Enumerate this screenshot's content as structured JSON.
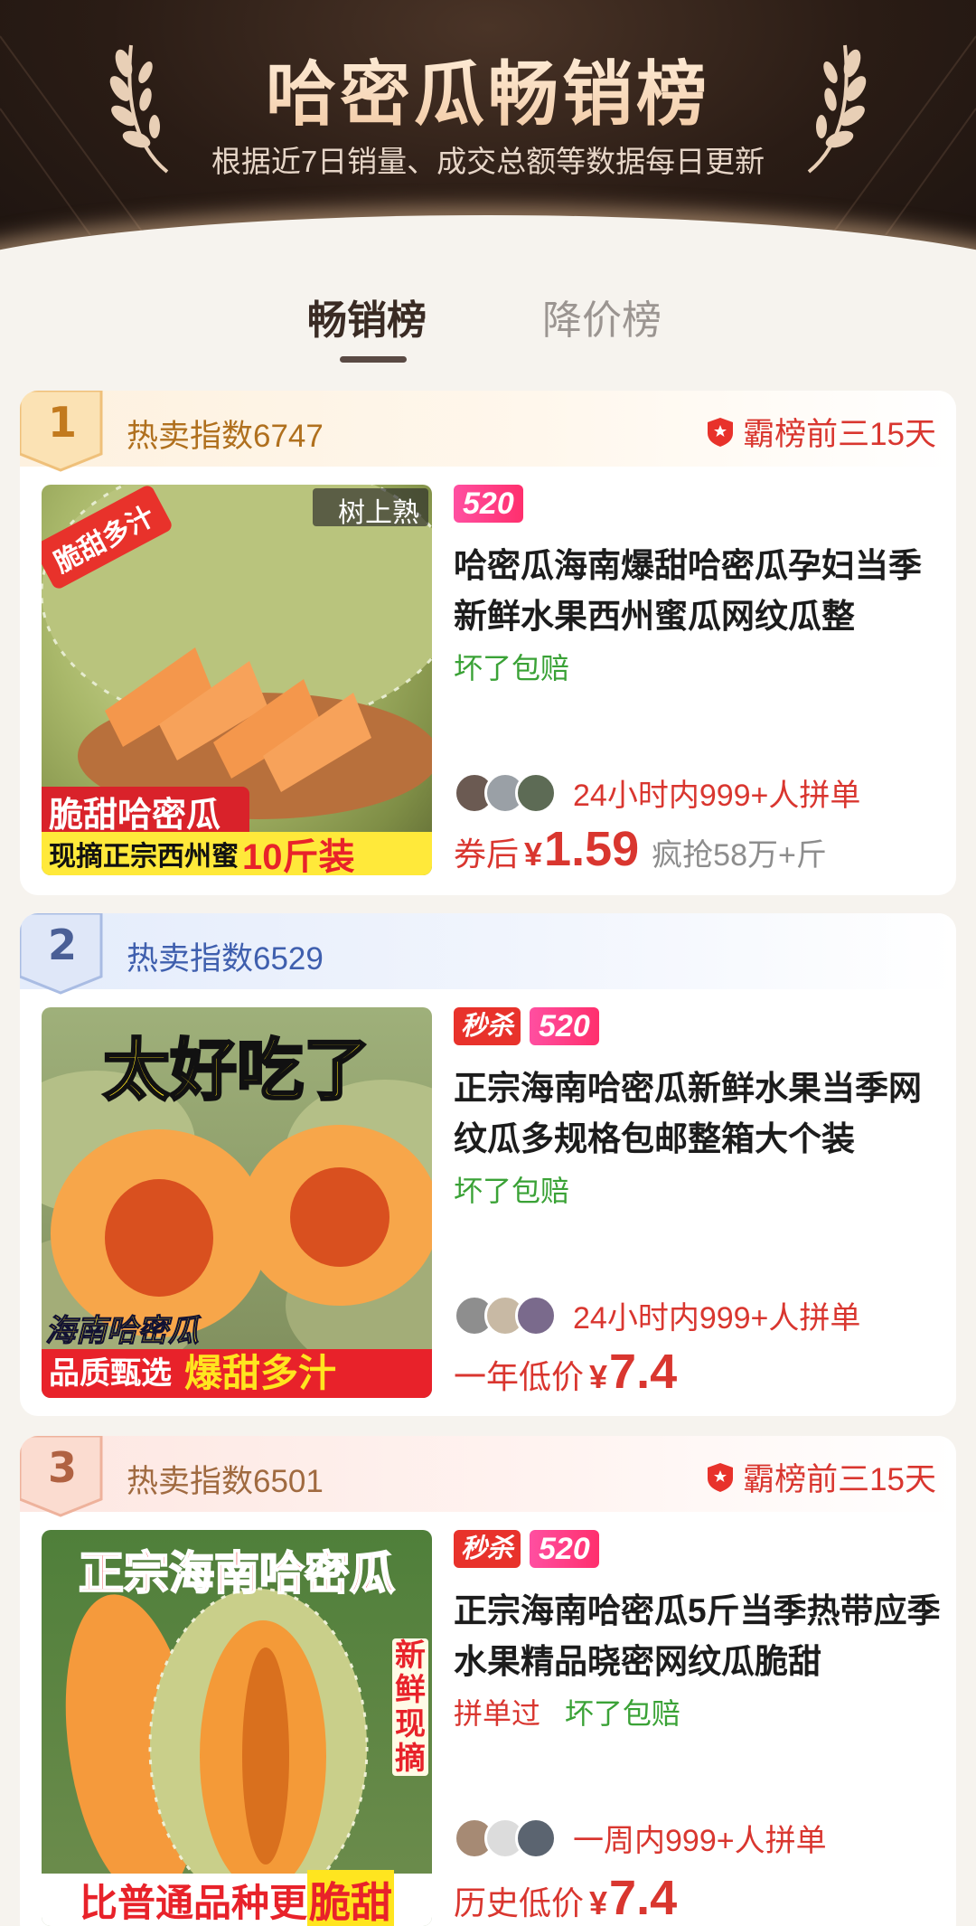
{
  "header": {
    "title": "哈密瓜畅销榜",
    "subtitle": "根据近7日销量、成交总额等数据每日更新"
  },
  "tabs": [
    {
      "label": "畅销榜",
      "active": true
    },
    {
      "label": "降价榜",
      "active": false
    }
  ],
  "colors": {
    "price_red": "#d9362f",
    "guarantee_green": "#3aa236",
    "tag_pink": "#ff2f6d"
  },
  "items": [
    {
      "rank": "1",
      "hot_index": "热卖指数6747",
      "top3": "霸榜前三15天",
      "image": {
        "corner": "树上熟",
        "badge": "脆甜多汁",
        "line1": "脆甜哈密瓜",
        "line2a": "现摘正宗西州蜜",
        "line2b": "10斤装"
      },
      "tags": [
        "520"
      ],
      "title": "哈密瓜海南爆甜哈密瓜孕妇当季新鲜水果西州蜜瓜网纹瓜整",
      "guarantees": [
        "坏了包赔"
      ],
      "group_text": "24小时内999+人拼单",
      "price_prefix": "券后",
      "currency": "¥",
      "price": "1.59",
      "sold": "疯抢58万+斤"
    },
    {
      "rank": "2",
      "hot_index": "热卖指数6529",
      "image": {
        "headline": "太好吃了",
        "line1": "海南哈密瓜",
        "line2a": "品质甄选",
        "line2b": "爆甜多汁"
      },
      "tags": [
        "秒杀",
        "520"
      ],
      "title": "正宗海南哈密瓜新鲜水果当季网纹瓜多规格包邮整箱大个装",
      "guarantees": [
        "坏了包赔"
      ],
      "group_text": "24小时内999+人拼单",
      "price_prefix": "一年低价",
      "currency": "¥",
      "price": "7.4"
    },
    {
      "rank": "3",
      "hot_index": "热卖指数6501",
      "top3": "霸榜前三15天",
      "image": {
        "headline": "正宗海南哈密瓜",
        "side": "新鲜现摘",
        "line_a": "比普通品种更",
        "line_b": "脆甜"
      },
      "tags": [
        "秒杀",
        "520"
      ],
      "title": "正宗海南哈密瓜5斤当季热带应季水果精品晓密网纹瓜脆甜",
      "guarantees_red": "拼单过",
      "guarantees": [
        "坏了包赔"
      ],
      "group_text": "一周内999+人拼单",
      "price_prefix": "历史低价",
      "currency": "¥",
      "price": "7.4"
    }
  ]
}
